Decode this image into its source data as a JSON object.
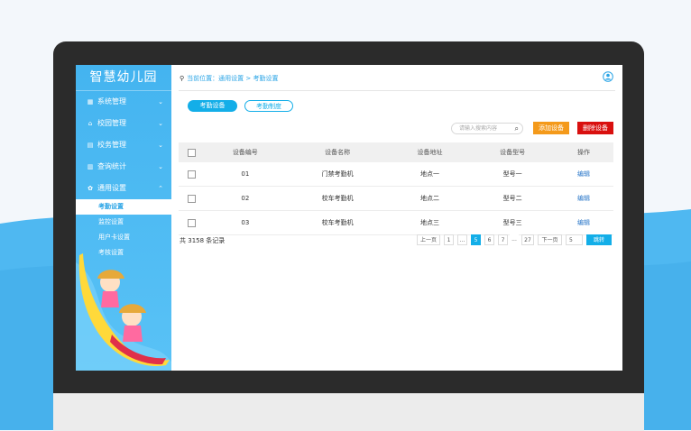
{
  "app": {
    "title": "智慧幼儿园"
  },
  "sidebar": {
    "items": [
      {
        "label": "系统管理",
        "icon": "grid-icon",
        "expanded": false
      },
      {
        "label": "校园管理",
        "icon": "building-icon",
        "expanded": false
      },
      {
        "label": "校务管理",
        "icon": "card-icon",
        "expanded": false
      },
      {
        "label": "查询统计",
        "icon": "chart-icon",
        "expanded": false
      },
      {
        "label": "通用设置",
        "icon": "gear-icon",
        "expanded": true
      }
    ],
    "subitems": [
      {
        "label": "考勤设置",
        "active": true
      },
      {
        "label": "监控设置",
        "active": false
      },
      {
        "label": "用户卡设置",
        "active": false
      },
      {
        "label": "考核设置",
        "active": false
      }
    ]
  },
  "header": {
    "breadcrumb": "当前位置：通用设置 > 考勤设置"
  },
  "tabs": [
    {
      "label": "考勤设备",
      "active": true
    },
    {
      "label": "考勤制度",
      "active": false
    }
  ],
  "search": {
    "placeholder": "请输入搜索内容"
  },
  "actions": {
    "add": "添加设备",
    "delete": "删除设备"
  },
  "table": {
    "headers": [
      "设备编号",
      "设备名称",
      "设备地址",
      "设备型号",
      "操作"
    ],
    "rows": [
      [
        "01",
        "门禁考勤机",
        "地点一",
        "型号一",
        "编辑"
      ],
      [
        "02",
        "校车考勤机",
        "地点二",
        "型号二",
        "编辑"
      ],
      [
        "03",
        "校车考勤机",
        "地点三",
        "型号三",
        "编辑"
      ]
    ]
  },
  "footer": {
    "total_prefix": "共",
    "total_count": "3158",
    "total_suffix": "条记录"
  },
  "pagination": {
    "prev": "上一页",
    "first": "1",
    "ellipsis": "...",
    "p5": "5",
    "p6": "6",
    "p7": "7",
    "last": "27",
    "next": "下一页",
    "jump_value": "5",
    "go": "跳转"
  },
  "colors": {
    "accent": "#13aee8",
    "add": "#f49a1b",
    "delete": "#d9100f",
    "sidebar": "#4ab9f3"
  }
}
